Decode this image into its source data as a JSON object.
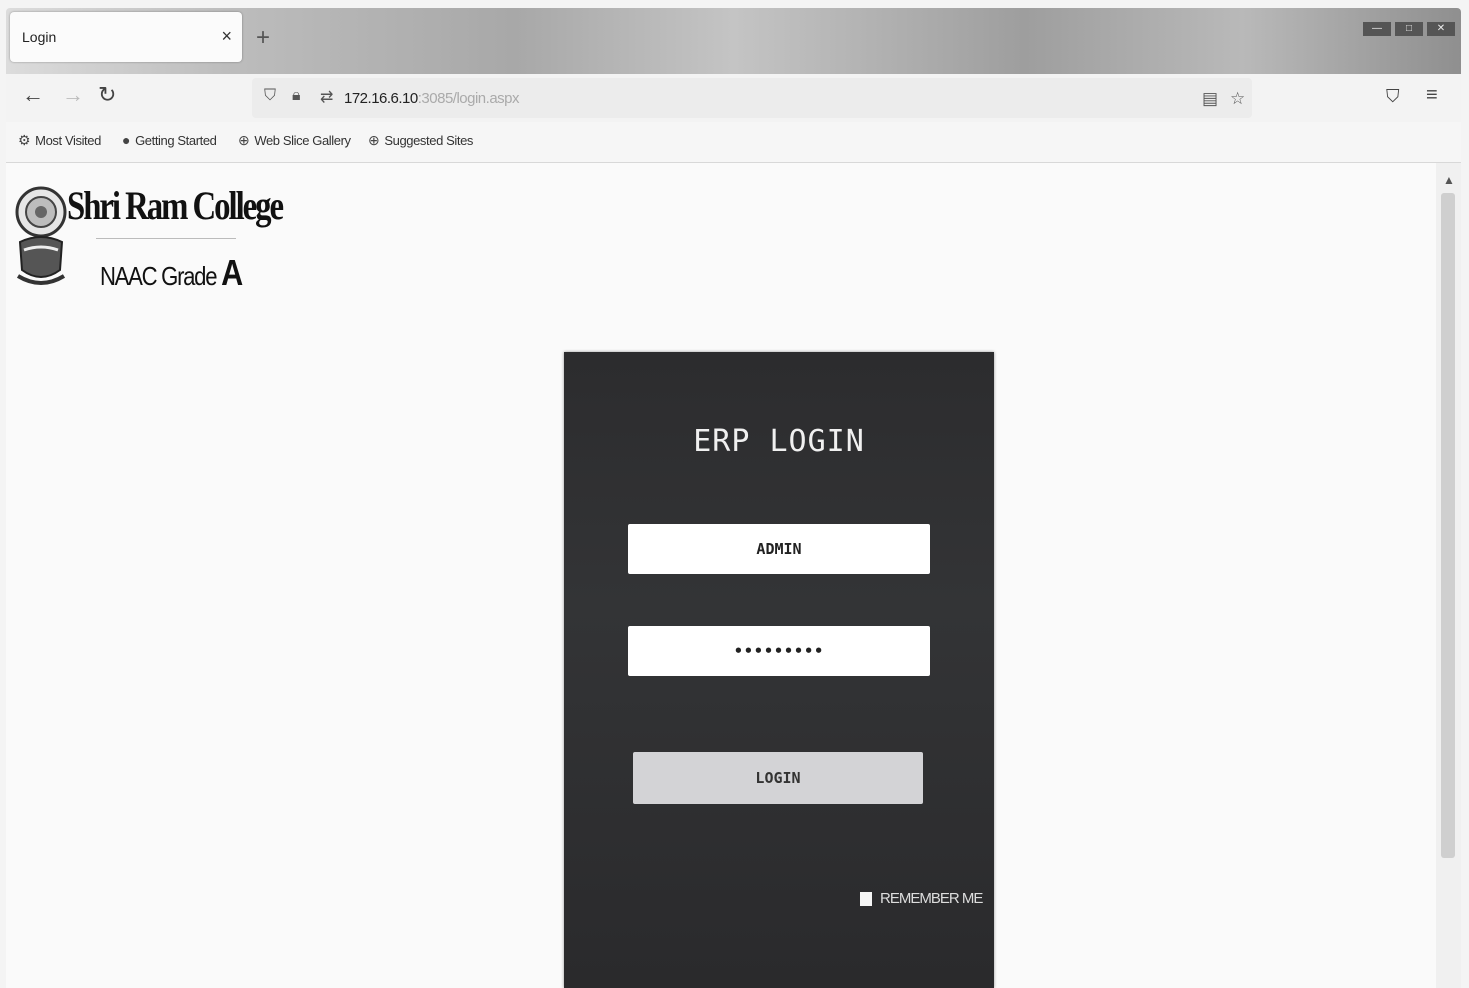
{
  "browser": {
    "tab_title": "Login",
    "tab_close": "×",
    "new_tab": "+",
    "url_host": "172.16.6.10",
    "url_path": ":3085/login.aspx",
    "bookmarks": [
      {
        "label": "Most Visited",
        "icon": "gear-icon"
      },
      {
        "label": "Getting Started",
        "icon": "firefox-icon"
      },
      {
        "label": "Web Slice Gallery",
        "icon": "globe-icon"
      },
      {
        "label": "Suggested Sites",
        "icon": "globe-icon"
      }
    ]
  },
  "page": {
    "college_name": "Shri Ram College",
    "naac_text": "NAAC Grade",
    "naac_grade": "A",
    "login": {
      "title": "ERP LOGIN",
      "username_value": "ADMIN",
      "password_value": "•••••••••",
      "login_button": "LOGIN",
      "remember_label": "REMEMBER ME"
    }
  },
  "colors": {
    "panel_bg": "#2f3032",
    "button_bg": "#d3d3d6"
  }
}
